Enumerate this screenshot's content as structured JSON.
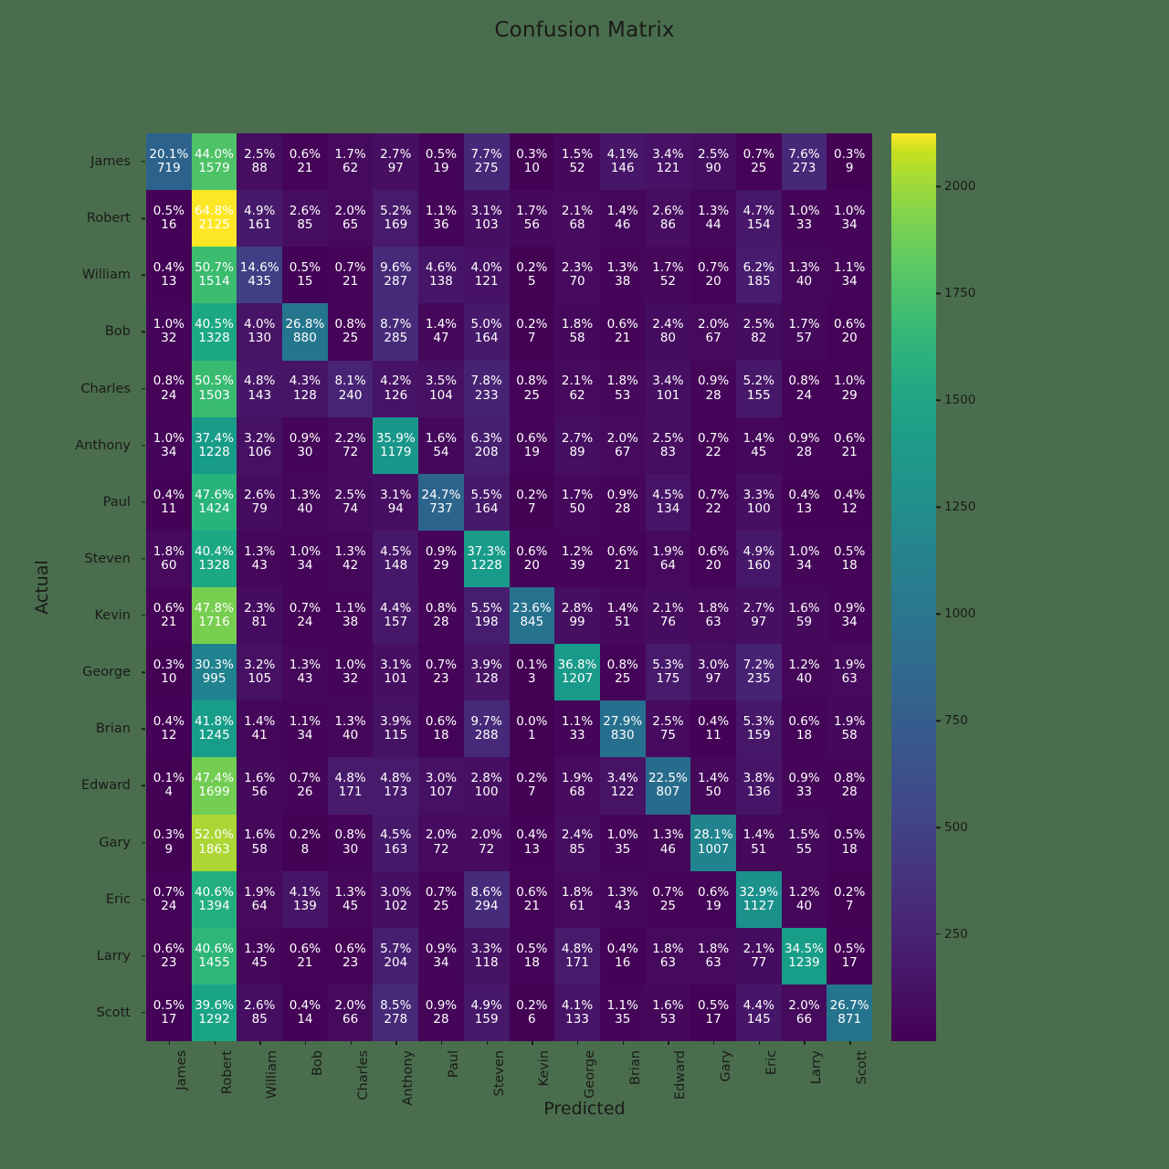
{
  "chart_data": {
    "type": "heatmap",
    "title": "Confusion Matrix",
    "xlabel": "Predicted",
    "ylabel": "Actual",
    "colormap": "viridis",
    "cmin": 0,
    "cmax": 2125,
    "colorbar_ticks": [
      250,
      500,
      750,
      1000,
      1250,
      1500,
      1750,
      2000
    ],
    "colorbar_position": "right",
    "grid": false,
    "cell_annotation": "percent_of_row_on_top_count_below",
    "categories": [
      "James",
      "Robert",
      "William",
      "Bob",
      "Charles",
      "Anthony",
      "Paul",
      "Steven",
      "Kevin",
      "George",
      "Brian",
      "Edward",
      "Gary",
      "Eric",
      "Larry",
      "Scott"
    ],
    "x_tick_labels": [
      "James",
      "Robert",
      "William",
      "Bob",
      "Charles",
      "Anthony",
      "Paul",
      "Steven",
      "Kevin",
      "George",
      "Brian",
      "Edward",
      "Gary",
      "Eric",
      "Larry",
      "Scott"
    ],
    "y_tick_labels": [
      "James",
      "Robert",
      "William",
      "Bob",
      "Charles",
      "Anthony",
      "Paul",
      "Steven",
      "Kevin",
      "George",
      "Brian",
      "Edward",
      "Gary",
      "Eric",
      "Larry",
      "Scott"
    ],
    "counts": [
      [
        719,
        1579,
        88,
        21,
        62,
        97,
        19,
        275,
        10,
        52,
        146,
        121,
        90,
        25,
        273,
        9
      ],
      [
        16,
        2125,
        161,
        85,
        65,
        169,
        36,
        103,
        56,
        68,
        46,
        86,
        44,
        154,
        33,
        34
      ],
      [
        13,
        1514,
        435,
        15,
        21,
        287,
        138,
        121,
        5,
        70,
        38,
        52,
        20,
        185,
        40,
        34
      ],
      [
        32,
        1328,
        130,
        880,
        25,
        285,
        47,
        164,
        7,
        58,
        21,
        80,
        67,
        82,
        57,
        20
      ],
      [
        24,
        1503,
        143,
        128,
        240,
        126,
        104,
        233,
        25,
        62,
        53,
        101,
        28,
        155,
        24,
        29
      ],
      [
        34,
        1228,
        106,
        30,
        72,
        1179,
        54,
        208,
        19,
        89,
        67,
        83,
        22,
        45,
        28,
        21
      ],
      [
        11,
        1424,
        79,
        40,
        74,
        94,
        737,
        164,
        7,
        50,
        28,
        134,
        22,
        100,
        13,
        12
      ],
      [
        60,
        1328,
        43,
        34,
        42,
        148,
        29,
        1228,
        20,
        39,
        21,
        64,
        20,
        160,
        34,
        18
      ],
      [
        21,
        1716,
        81,
        24,
        38,
        157,
        28,
        198,
        845,
        99,
        51,
        76,
        63,
        97,
        59,
        34
      ],
      [
        10,
        995,
        105,
        43,
        32,
        101,
        23,
        128,
        3,
        1207,
        25,
        175,
        97,
        235,
        40,
        63
      ],
      [
        12,
        1245,
        41,
        34,
        40,
        115,
        18,
        288,
        1,
        33,
        830,
        75,
        11,
        159,
        18,
        58
      ],
      [
        4,
        1699,
        56,
        26,
        171,
        173,
        107,
        100,
        7,
        68,
        122,
        807,
        50,
        136,
        33,
        28
      ],
      [
        9,
        1863,
        58,
        8,
        30,
        163,
        72,
        72,
        13,
        85,
        35,
        46,
        1007,
        51,
        55,
        18
      ],
      [
        24,
        1394,
        64,
        139,
        45,
        102,
        25,
        294,
        21,
        61,
        43,
        25,
        19,
        1127,
        40,
        7
      ],
      [
        23,
        1455,
        45,
        21,
        23,
        204,
        34,
        118,
        18,
        171,
        16,
        63,
        63,
        77,
        1239,
        17
      ],
      [
        17,
        1292,
        85,
        14,
        66,
        278,
        28,
        159,
        6,
        133,
        35,
        53,
        17,
        145,
        66,
        871
      ]
    ],
    "percents": [
      [
        "20.1%",
        "44.0%",
        "2.5%",
        "0.6%",
        "1.7%",
        "2.7%",
        "0.5%",
        "7.7%",
        "0.3%",
        "1.5%",
        "4.1%",
        "3.4%",
        "2.5%",
        "0.7%",
        "7.6%",
        "0.3%"
      ],
      [
        "0.5%",
        "64.8%",
        "4.9%",
        "2.6%",
        "2.0%",
        "5.2%",
        "1.1%",
        "3.1%",
        "1.7%",
        "2.1%",
        "1.4%",
        "2.6%",
        "1.3%",
        "4.7%",
        "1.0%",
        "1.0%"
      ],
      [
        "0.4%",
        "50.7%",
        "14.6%",
        "0.5%",
        "0.7%",
        "9.6%",
        "4.6%",
        "4.0%",
        "0.2%",
        "2.3%",
        "1.3%",
        "1.7%",
        "0.7%",
        "6.2%",
        "1.3%",
        "1.1%"
      ],
      [
        "1.0%",
        "40.5%",
        "4.0%",
        "26.8%",
        "0.8%",
        "8.7%",
        "1.4%",
        "5.0%",
        "0.2%",
        "1.8%",
        "0.6%",
        "2.4%",
        "2.0%",
        "2.5%",
        "1.7%",
        "0.6%"
      ],
      [
        "0.8%",
        "50.5%",
        "4.8%",
        "4.3%",
        "8.1%",
        "4.2%",
        "3.5%",
        "7.8%",
        "0.8%",
        "2.1%",
        "1.8%",
        "3.4%",
        "0.9%",
        "5.2%",
        "0.8%",
        "1.0%"
      ],
      [
        "1.0%",
        "37.4%",
        "3.2%",
        "0.9%",
        "2.2%",
        "35.9%",
        "1.6%",
        "6.3%",
        "0.6%",
        "2.7%",
        "2.0%",
        "2.5%",
        "0.7%",
        "1.4%",
        "0.9%",
        "0.6%"
      ],
      [
        "0.4%",
        "47.6%",
        "2.6%",
        "1.3%",
        "2.5%",
        "3.1%",
        "24.7%",
        "5.5%",
        "0.2%",
        "1.7%",
        "0.9%",
        "4.5%",
        "0.7%",
        "3.3%",
        "0.4%",
        "0.4%"
      ],
      [
        "1.8%",
        "40.4%",
        "1.3%",
        "1.0%",
        "1.3%",
        "4.5%",
        "0.9%",
        "37.3%",
        "0.6%",
        "1.2%",
        "0.6%",
        "1.9%",
        "0.6%",
        "4.9%",
        "1.0%",
        "0.5%"
      ],
      [
        "0.6%",
        "47.8%",
        "2.3%",
        "0.7%",
        "1.1%",
        "4.4%",
        "0.8%",
        "5.5%",
        "23.6%",
        "2.8%",
        "1.4%",
        "2.1%",
        "1.8%",
        "2.7%",
        "1.6%",
        "0.9%"
      ],
      [
        "0.3%",
        "30.3%",
        "3.2%",
        "1.3%",
        "1.0%",
        "3.1%",
        "0.7%",
        "3.9%",
        "0.1%",
        "36.8%",
        "0.8%",
        "5.3%",
        "3.0%",
        "7.2%",
        "1.2%",
        "1.9%"
      ],
      [
        "0.4%",
        "41.8%",
        "1.4%",
        "1.1%",
        "1.3%",
        "3.9%",
        "0.6%",
        "9.7%",
        "0.0%",
        "1.1%",
        "27.9%",
        "2.5%",
        "0.4%",
        "5.3%",
        "0.6%",
        "1.9%"
      ],
      [
        "0.1%",
        "47.4%",
        "1.6%",
        "0.7%",
        "4.8%",
        "4.8%",
        "3.0%",
        "2.8%",
        "0.2%",
        "1.9%",
        "3.4%",
        "22.5%",
        "1.4%",
        "3.8%",
        "0.9%",
        "0.8%"
      ],
      [
        "0.3%",
        "52.0%",
        "1.6%",
        "0.2%",
        "0.8%",
        "4.5%",
        "2.0%",
        "2.0%",
        "0.4%",
        "2.4%",
        "1.0%",
        "1.3%",
        "28.1%",
        "1.4%",
        "1.5%",
        "0.5%"
      ],
      [
        "0.7%",
        "40.6%",
        "1.9%",
        "4.1%",
        "1.3%",
        "3.0%",
        "0.7%",
        "8.6%",
        "0.6%",
        "1.8%",
        "1.3%",
        "0.7%",
        "0.6%",
        "32.9%",
        "1.2%",
        "0.2%"
      ],
      [
        "0.6%",
        "40.6%",
        "1.3%",
        "0.6%",
        "0.6%",
        "5.7%",
        "0.9%",
        "3.3%",
        "0.5%",
        "4.8%",
        "0.4%",
        "1.8%",
        "1.8%",
        "2.1%",
        "34.5%",
        "0.5%"
      ],
      [
        "0.5%",
        "39.6%",
        "2.6%",
        "0.4%",
        "2.0%",
        "8.5%",
        "0.9%",
        "4.9%",
        "0.2%",
        "4.1%",
        "1.1%",
        "1.6%",
        "0.5%",
        "4.4%",
        "2.0%",
        "26.7%"
      ]
    ]
  },
  "figure": {
    "background_color": "#4a6e4d",
    "text_color": "#1a1a1a",
    "annotation_color": "#ffffff"
  }
}
